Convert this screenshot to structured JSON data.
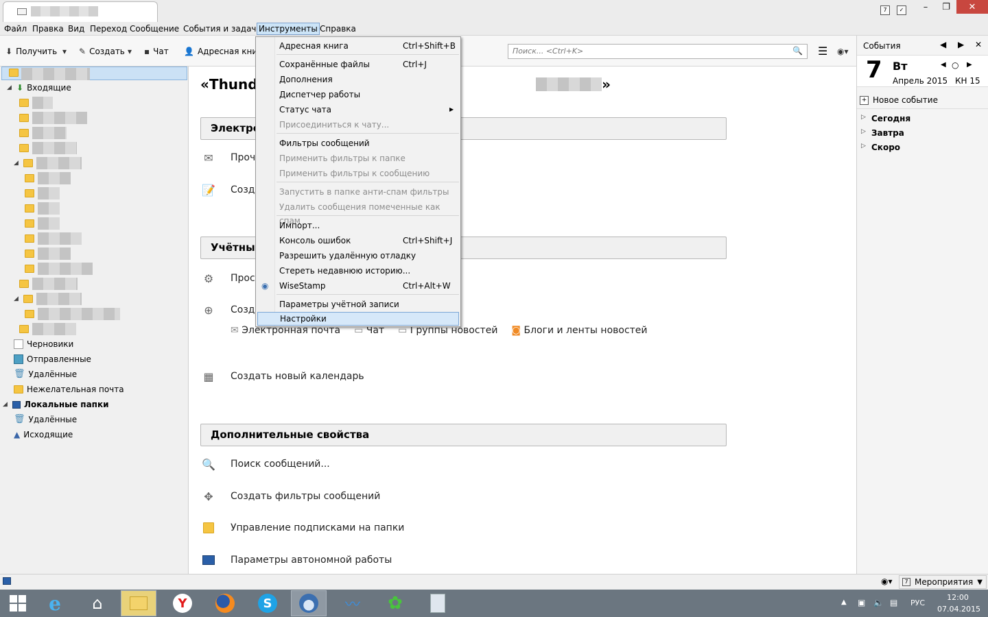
{
  "menubar": {
    "items": [
      "Файл",
      "Правка",
      "Вид",
      "Переход",
      "Сообщение",
      "События и задачи",
      "Инструменты",
      "Справка"
    ]
  },
  "toolbar": {
    "get_label": "Получить",
    "create_label": "Создать",
    "chat_label": "Чат",
    "addressbook_label": "Адресная книга",
    "search_placeholder": "Поиск... <Ctrl+K>"
  },
  "folders": {
    "inbox": "Входящие",
    "drafts": "Черновики",
    "sent": "Отправленные",
    "deleted": "Удалённые",
    "junk": "Нежелательная почта",
    "local_folders": "Локальные папки",
    "local_deleted": "Удалённые",
    "outbox": "Исходящие"
  },
  "main": {
    "title_prefix": "«Thunde",
    "title_suffix": "»",
    "section_email": "Электро",
    "email_read": "Проч",
    "email_write": "Созда",
    "section_accounts": "Учётны",
    "acc_view": "Прос",
    "acc_create": "Созда",
    "acc_types": [
      "Электронная почта",
      "Чат",
      "Группы новостей",
      "Блоги и ленты новостей"
    ],
    "create_calendar": "Создать новый календарь",
    "section_advanced": "Дополнительные свойства",
    "adv_items": [
      "Поиск сообщений...",
      "Создать фильтры сообщений",
      "Управление подписками на папки",
      "Параметры автономной работы"
    ]
  },
  "dropdown": {
    "items": [
      {
        "label": "Адресная книга",
        "shortcut": "Ctrl+Shift+B"
      },
      {
        "label": "Сохранённые файлы",
        "shortcut": "Ctrl+J"
      },
      {
        "label": "Дополнения",
        "shortcut": ""
      },
      {
        "label": "Диспетчер работы",
        "shortcut": ""
      },
      {
        "label": "Статус чата",
        "shortcut": ""
      },
      {
        "label": "Присоединиться к чату...",
        "shortcut": ""
      },
      {
        "label": "Фильтры сообщений",
        "shortcut": ""
      },
      {
        "label": "Применить фильтры к папке",
        "shortcut": ""
      },
      {
        "label": "Применить фильтры к сообщению",
        "shortcut": ""
      },
      {
        "label": "Запустить в папке анти-спам фильтры",
        "shortcut": ""
      },
      {
        "label": "Удалить сообщения помеченные как спам",
        "shortcut": ""
      },
      {
        "label": "Импорт...",
        "shortcut": ""
      },
      {
        "label": "Консоль ошибок",
        "shortcut": "Ctrl+Shift+J"
      },
      {
        "label": "Разрешить удалённую отладку",
        "shortcut": ""
      },
      {
        "label": "Стереть недавнюю историю...",
        "shortcut": ""
      },
      {
        "label": "WiseStamp",
        "shortcut": "Ctrl+Alt+W"
      },
      {
        "label": "Параметры учётной записи",
        "shortcut": ""
      },
      {
        "label": "Настройки",
        "shortcut": ""
      }
    ]
  },
  "events_pane": {
    "title": "События",
    "day_number": "7",
    "weekday": "Вт",
    "month_year": "Апрель 2015",
    "week": "КН 15",
    "new_event": "Новое событие",
    "groups": [
      "Сегодня",
      "Завтра",
      "Скоро"
    ]
  },
  "statusbar": {
    "events_label": "Мероприятия"
  },
  "taskbar": {
    "lang": "РУС",
    "time": "12:00",
    "date": "07.04.2015"
  },
  "titlebar": {
    "cal_day": "7"
  }
}
